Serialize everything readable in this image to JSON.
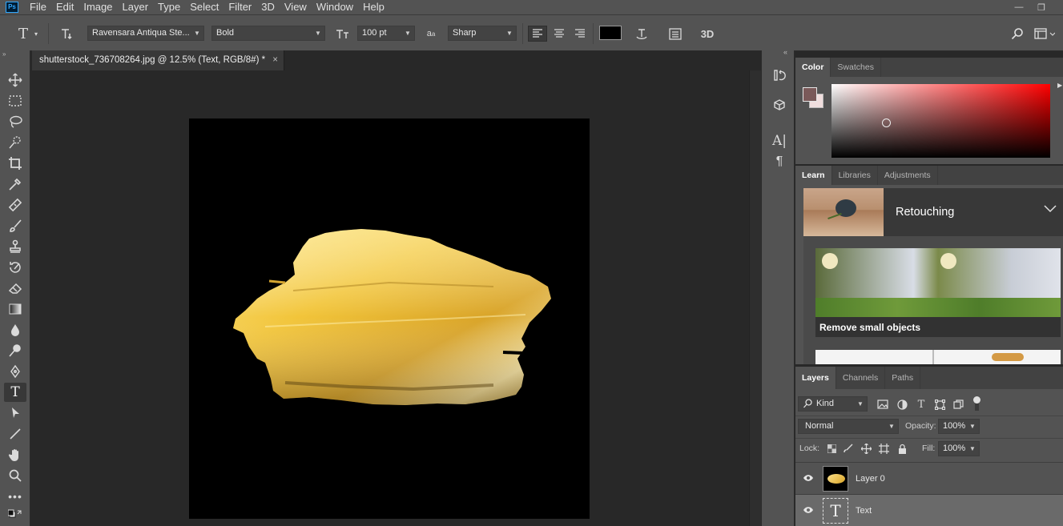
{
  "app": {
    "logo_text": "Ps"
  },
  "menu": [
    "File",
    "Edit",
    "Image",
    "Layer",
    "Type",
    "Select",
    "Filter",
    "3D",
    "View",
    "Window",
    "Help"
  ],
  "options_bar": {
    "font_family": "Ravensara Antiqua Ste...",
    "font_style": "Bold",
    "font_size": "100 pt",
    "antialias": "Sharp",
    "text_color": "#000000",
    "three_d_label": "3D"
  },
  "document": {
    "tab_title": "shutterstock_736708264.jpg @ 12.5% (Text, RGB/8#) *",
    "close_glyph": "×"
  },
  "color_panel": {
    "tabs": [
      "Color",
      "Swatches"
    ],
    "active_tab": "Color",
    "foreground": "#7a5959",
    "background": "#f0dede",
    "hue": "#ff0000"
  },
  "learn_panel": {
    "tabs": [
      "Learn",
      "Libraries",
      "Adjustments"
    ],
    "active_tab": "Learn",
    "header_title": "Retouching",
    "card_title": "Remove small objects"
  },
  "layers_panel": {
    "tabs": [
      "Layers",
      "Channels",
      "Paths"
    ],
    "active_tab": "Layers",
    "filter_kind": "Kind",
    "blend_mode": "Normal",
    "opacity_label": "Opacity:",
    "opacity_value": "100%",
    "lock_label": "Lock:",
    "fill_label": "Fill:",
    "fill_value": "100%",
    "layers": [
      {
        "name": "Layer 0",
        "type": "image"
      },
      {
        "name": "Text",
        "type": "text",
        "selected": true
      }
    ]
  }
}
